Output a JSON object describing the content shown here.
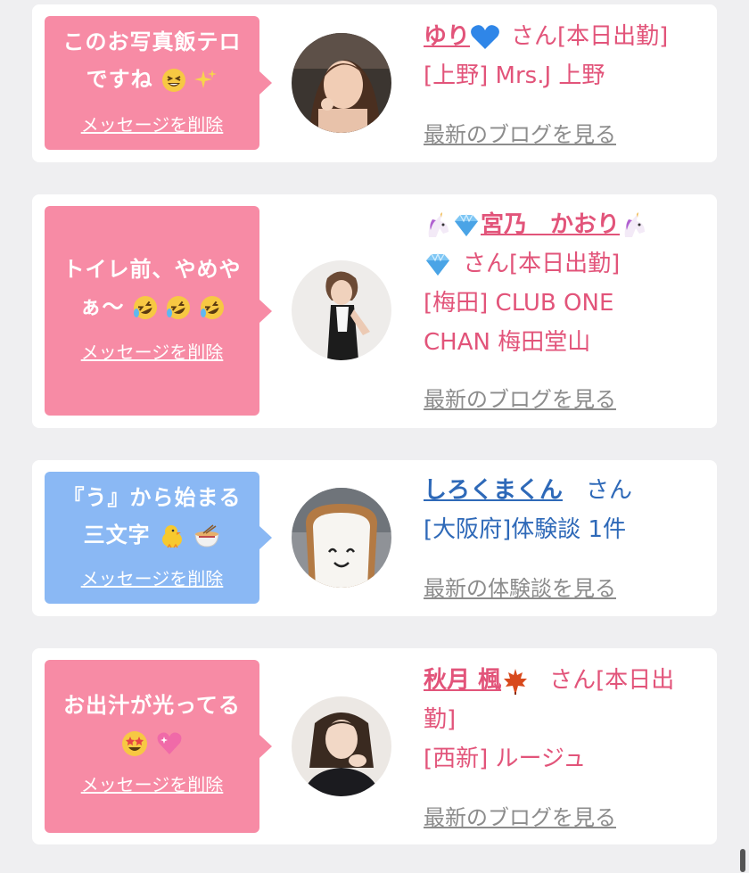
{
  "cards": [
    {
      "bubble_lines": [
        "このお写真飯テロ",
        "ですね"
      ],
      "bubble_color": "#f78ba5",
      "delete_label": "メッセージを削除",
      "name": "ゆり",
      "san": "さん[本日出勤]",
      "shop": "[上野] Mrs.J 上野",
      "more": "最新のブログを見る"
    },
    {
      "bubble_lines": [
        "トイレ前、やめや",
        "ぁ〜"
      ],
      "bubble_color": "#f78ba5",
      "delete_label": "メッセージを削除",
      "name": "宮乃　かおり",
      "san": "さん[本日出勤]",
      "shop_lines": [
        "[梅田] CLUB ONE",
        "CHAN 梅田堂山"
      ],
      "more": "最新のブログを見る"
    },
    {
      "bubble_lines": [
        "『う』から始まる",
        "三文字"
      ],
      "bubble_color": "#8ab8f4",
      "delete_label": "メッセージを削除",
      "name": "しろくまくん",
      "san": "さん",
      "shop": "[大阪府]体験談 1件",
      "more": "最新の体験談を見る"
    },
    {
      "bubble_lines": [
        "お出汁が光ってる"
      ],
      "bubble_color": "#f78ba5",
      "delete_label": "メッセージを削除",
      "name": "秋月 楓",
      "san_lines": [
        "さん[本日出",
        "勤]"
      ],
      "shop": "[西新] ルージュ",
      "more": "最新のブログを見る"
    }
  ],
  "colors": {
    "pink_text": "#e2547a",
    "blue_text": "#2e69b8",
    "pink_bubble": "#f78ba5",
    "blue_bubble": "#8ab8f4",
    "link_gray": "#8c8c8c",
    "background": "#efeff1"
  }
}
